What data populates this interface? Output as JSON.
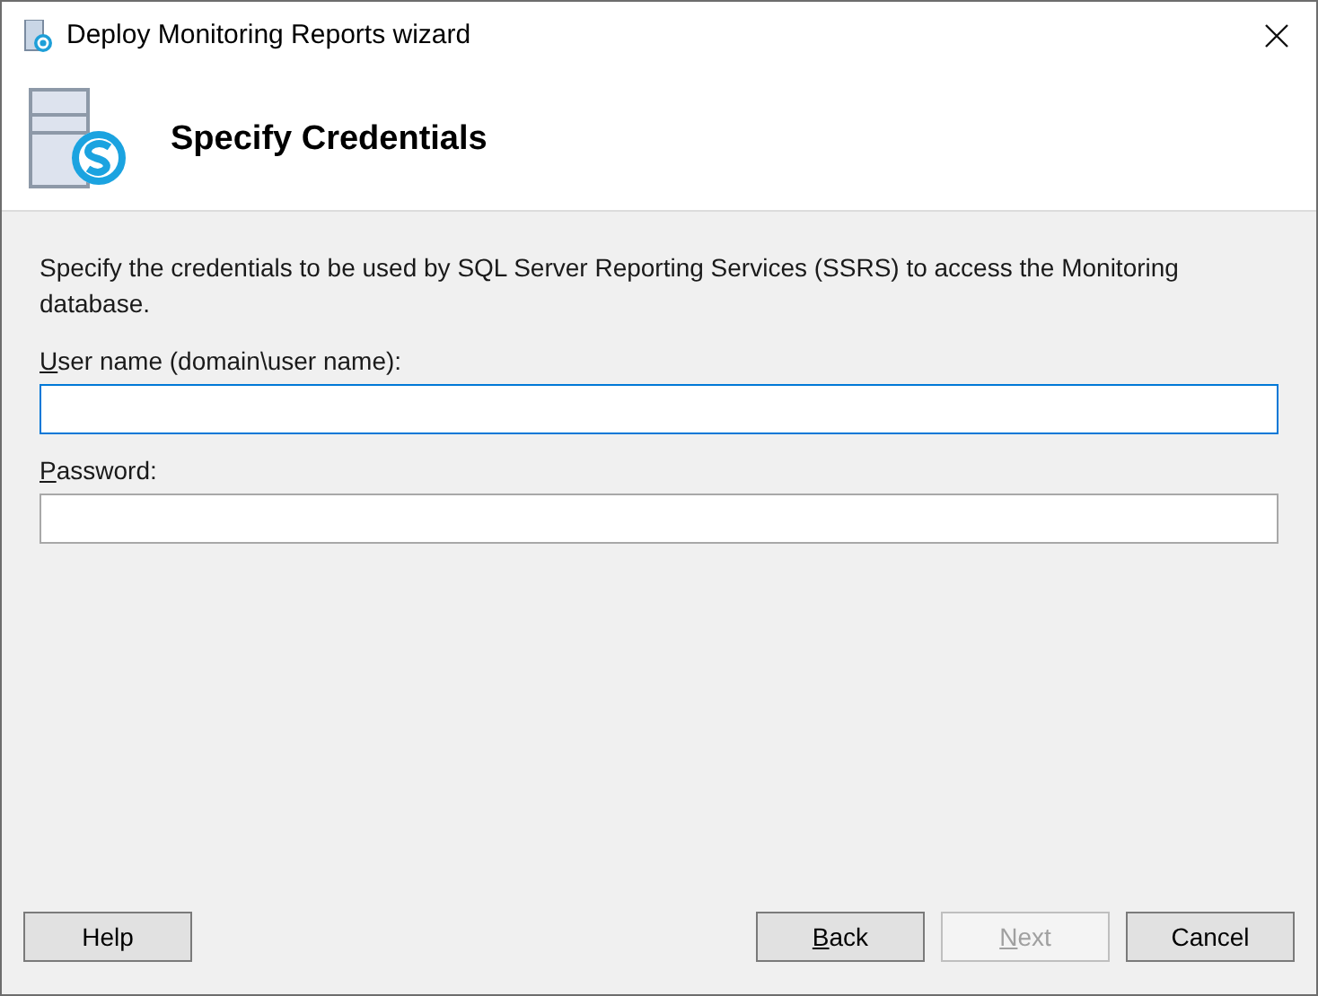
{
  "window": {
    "title": "Deploy Monitoring Reports wizard"
  },
  "header": {
    "title": "Specify Credentials"
  },
  "description": "Specify the credentials to be used by SQL Server Reporting Services (SSRS) to access the Monitoring database.",
  "fields": [
    {
      "label": "User name (domain\\user name):",
      "mnemonic": true,
      "focused": true
    },
    {
      "label": "Password:",
      "mnemonic": true,
      "focused": false
    }
  ],
  "buttons": [
    {
      "label": "Help",
      "mnemonic": false,
      "disabled": false
    },
    {
      "label": "Back",
      "mnemonic": true,
      "disabled": false
    },
    {
      "label": "Next",
      "mnemonic": true,
      "disabled": true
    },
    {
      "label": "Cancel",
      "mnemonic": false,
      "disabled": false
    }
  ]
}
